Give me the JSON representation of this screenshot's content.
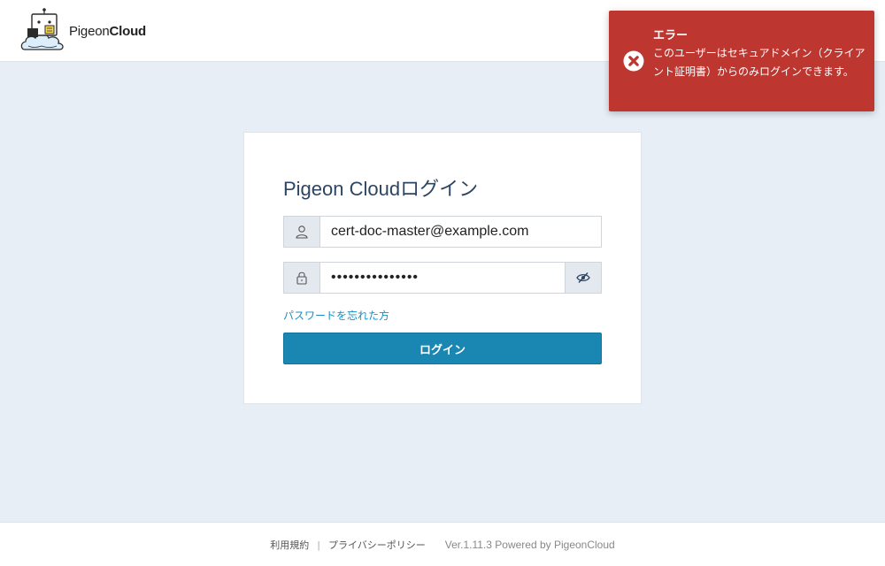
{
  "header": {
    "logo_name_regular": "Pigeon",
    "logo_name_bold": "Cloud",
    "logo_icon": "pigeon-robot-cloud-icon"
  },
  "toast": {
    "title": "エラー",
    "message": "このユーザーはセキュアドメイン（クライアント証明書）からのみログインできます。",
    "icon": "error-circle-x-icon",
    "color": "#bd362f"
  },
  "login": {
    "title": "Pigeon Cloudログイン",
    "email_value": "cert-doc-master@example.com",
    "password_value": "•••••••••••••••",
    "user_icon": "user-icon",
    "lock_icon": "lock-icon",
    "toggle_icon": "eye-slash-icon",
    "forgot_password": "パスワードを忘れた方",
    "submit_label": "ログイン",
    "accent_color": "#1a87b3",
    "link_color": "#1a8fc5"
  },
  "footer": {
    "terms": "利用規約",
    "separator": "|",
    "privacy": "プライバシーポリシー",
    "version": "Ver.1.11.3 Powered by PigeonCloud"
  }
}
